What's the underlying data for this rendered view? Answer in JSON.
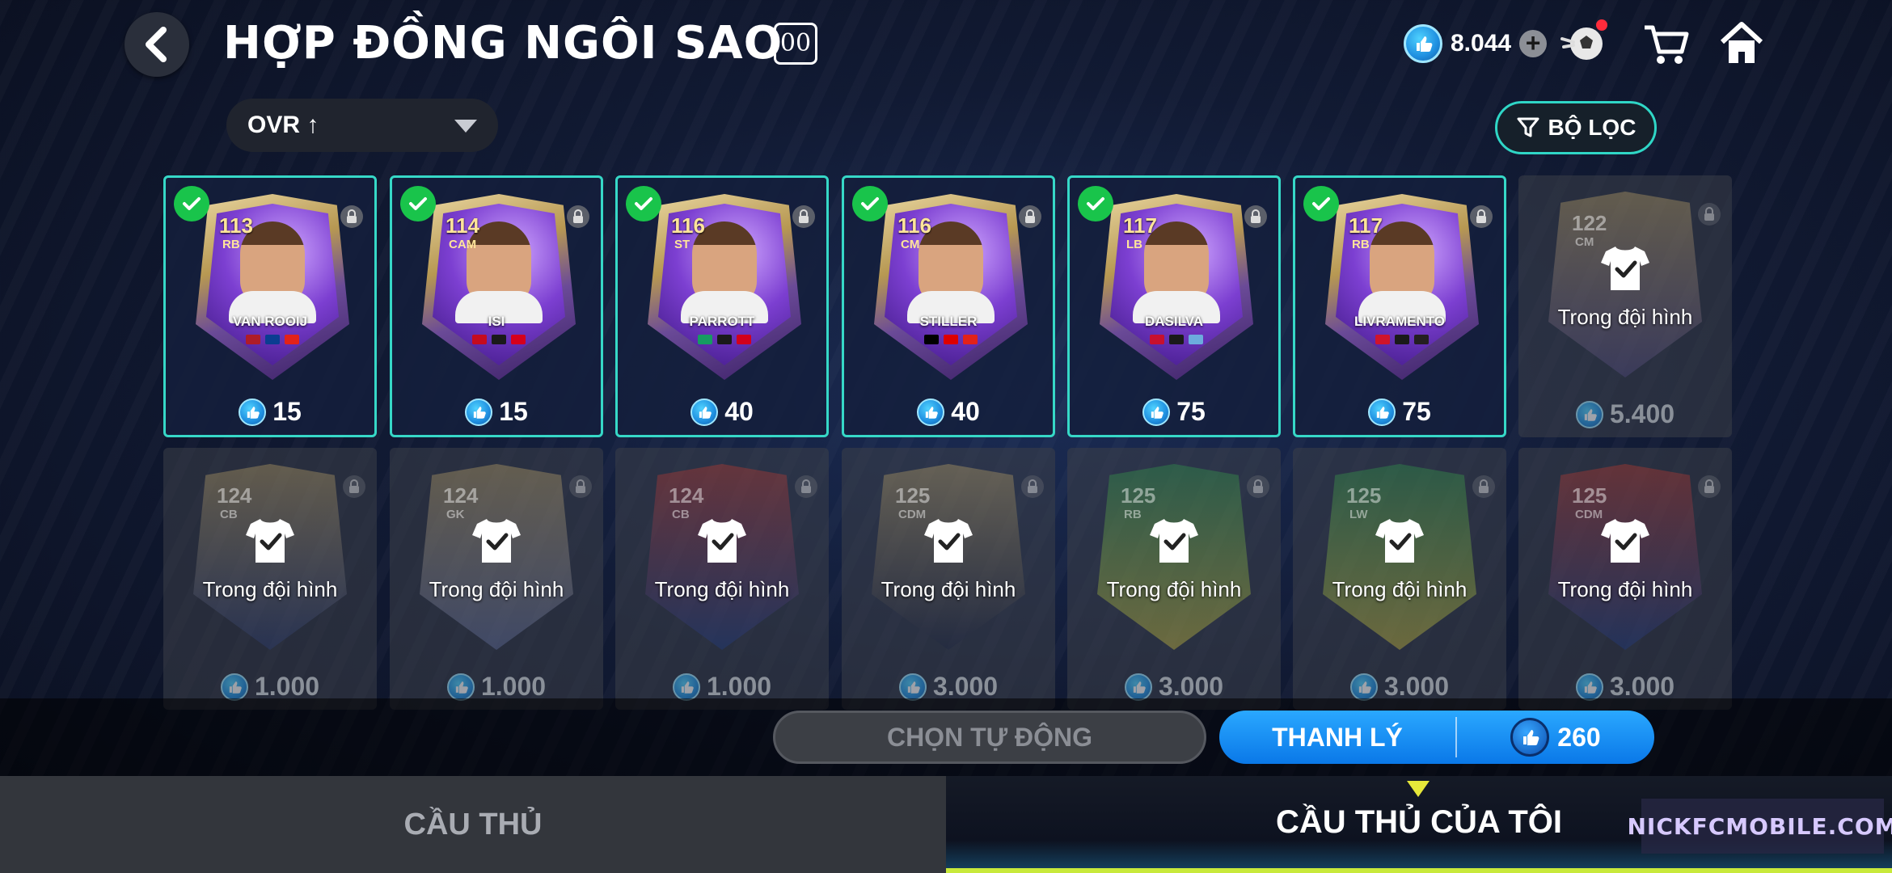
{
  "header": {
    "title": "HỢP ĐỒNG NGÔI SAO",
    "badge": "00",
    "currency_value": "8.044"
  },
  "sort": {
    "label": "OVR ↑"
  },
  "filter": {
    "label": "BỘ LỌC"
  },
  "owned_cards": [
    {
      "ovr": "113",
      "pos": "RB",
      "name": "VAN ROOIJ",
      "price": "15"
    },
    {
      "ovr": "114",
      "pos": "CAM",
      "name": "ISI",
      "price": "15"
    },
    {
      "ovr": "116",
      "pos": "ST",
      "name": "PARROTT",
      "price": "40"
    },
    {
      "ovr": "116",
      "pos": "CM",
      "name": "STILLER",
      "price": "40"
    },
    {
      "ovr": "117",
      "pos": "LB",
      "name": "DASILVA",
      "price": "75"
    },
    {
      "ovr": "117",
      "pos": "RB",
      "name": "LIVRAMENTO",
      "price": "75"
    }
  ],
  "locked_cards": [
    {
      "ovr": "122",
      "pos": "CM",
      "label": "Trong đội hình",
      "price": "5.400"
    },
    {
      "ovr": "124",
      "pos": "CB",
      "label": "Trong đội hình",
      "price": "1.000"
    },
    {
      "ovr": "124",
      "pos": "GK",
      "label": "Trong đội hình",
      "price": "1.000"
    },
    {
      "ovr": "124",
      "pos": "CB",
      "label": "Trong đội hình",
      "price": "1.000"
    },
    {
      "ovr": "125",
      "pos": "CDM",
      "label": "Trong đội hình",
      "price": "3.000"
    },
    {
      "ovr": "125",
      "pos": "RB",
      "label": "Trong đội hình",
      "price": "3.000"
    },
    {
      "ovr": "125",
      "pos": "LW",
      "label": "Trong đội hình",
      "price": "3.000"
    },
    {
      "ovr": "125",
      "pos": "CDM",
      "label": "Trong đội hình",
      "price": "3.000"
    }
  ],
  "actions": {
    "auto_select": "CHỌN TỰ ĐỘNG",
    "sell": "THANH LÝ",
    "sell_cost": "260"
  },
  "tabs": {
    "players": "CẦU THỦ",
    "my_players": "CẦU THỦ CỦA TÔI"
  },
  "watermark": "NICKFCMOBILE.COM",
  "colors": {
    "accent_teal": "#36d8c7",
    "sell_blue": "#1a90f4",
    "check_green": "#19c44b"
  }
}
